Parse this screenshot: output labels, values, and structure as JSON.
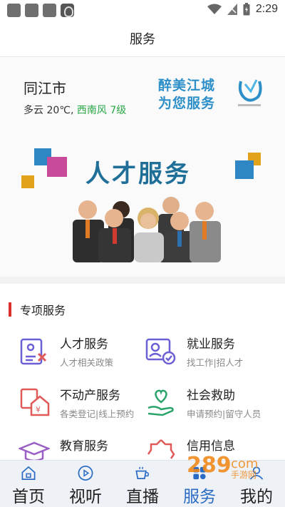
{
  "status_bar": {
    "time": "2:29"
  },
  "header": {
    "title": "服务"
  },
  "banner": {
    "city": "同江市",
    "weather": "多云 20℃,",
    "wind": "西南风 7级",
    "slogan_line1": "醉美江城",
    "slogan_line2": "为您服务",
    "title": "人才服务"
  },
  "section": {
    "title": "专项服务"
  },
  "services": [
    {
      "name": "人才服务",
      "desc": "人才相关政策",
      "icon": "talent-icon"
    },
    {
      "name": "就业服务",
      "desc": "找工作|招人才",
      "icon": "employment-icon"
    },
    {
      "name": "不动产服务",
      "desc": "各类登记|线上预约",
      "icon": "real-estate-icon"
    },
    {
      "name": "社会救助",
      "desc": "申请预约|留守人员",
      "icon": "social-aid-icon"
    },
    {
      "name": "教育服务",
      "desc": "",
      "icon": "education-icon"
    },
    {
      "name": "信用信息",
      "desc": "",
      "icon": "credit-icon"
    }
  ],
  "nav": {
    "items": [
      {
        "label": "首页",
        "icon": "home-icon"
      },
      {
        "label": "视听",
        "icon": "play-icon"
      },
      {
        "label": "直播",
        "icon": "coffee-icon"
      },
      {
        "label": "服务",
        "icon": "service-icon"
      },
      {
        "label": "我的",
        "icon": "user-icon"
      }
    ],
    "active_index": 3
  },
  "colors": {
    "accent": "#2a6cc4",
    "section_mark": "#d9302c",
    "wind": "#28a745",
    "slogan": "#2d8fc8"
  }
}
